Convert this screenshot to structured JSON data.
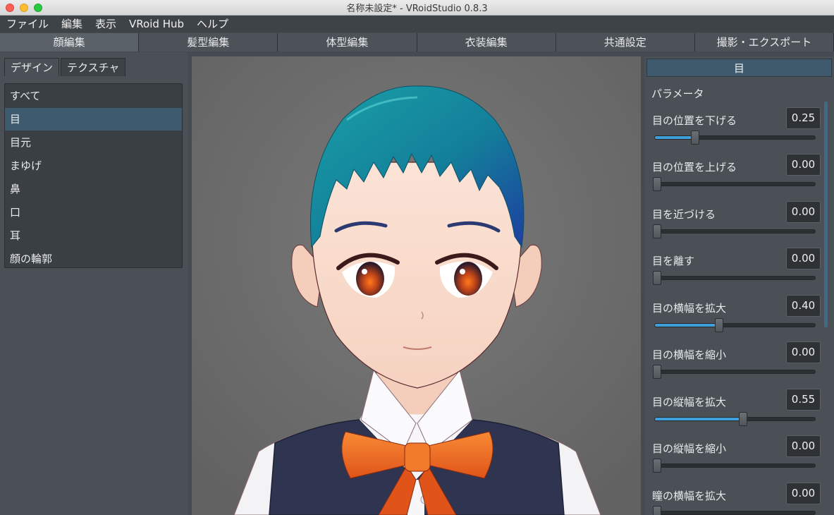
{
  "window": {
    "title": "名称未設定* - VRoidStudio 0.8.3"
  },
  "menu": [
    "ファイル",
    "編集",
    "表示",
    "VRoid Hub",
    "ヘルプ"
  ],
  "main_tabs": [
    "顔編集",
    "髪型編集",
    "体型編集",
    "衣装編集",
    "共通設定",
    "撮影・エクスポート"
  ],
  "sub_tabs": [
    "デザイン",
    "テクスチャ"
  ],
  "categories": [
    "すべて",
    "目",
    "目元",
    "まゆげ",
    "鼻",
    "口",
    "耳",
    "顔の輪郭"
  ],
  "selected_category": "目",
  "panel": {
    "header": "目",
    "section": "パラメータ",
    "params": [
      {
        "label": "目の位置を下げる",
        "value": "0.25",
        "level": 0.25
      },
      {
        "label": "目の位置を上げる",
        "value": "0.00",
        "level": 0.0
      },
      {
        "label": "目を近づける",
        "value": "0.00",
        "level": 0.0
      },
      {
        "label": "目を離す",
        "value": "0.00",
        "level": 0.0
      },
      {
        "label": "目の横幅を拡大",
        "value": "0.40",
        "level": 0.4
      },
      {
        "label": "目の横幅を縮小",
        "value": "0.00",
        "level": 0.0
      },
      {
        "label": "目の縦幅を拡大",
        "value": "0.55",
        "level": 0.55
      },
      {
        "label": "目の縦幅を縮小",
        "value": "0.00",
        "level": 0.0
      },
      {
        "label": "瞳の横幅を拡大",
        "value": "0.00",
        "level": 0.0
      }
    ]
  },
  "colors": {
    "accent": "#3f9fdb",
    "selection": "#3e5a6e",
    "hair": "#1a8fa0",
    "ribbon": "#f06a1a"
  }
}
